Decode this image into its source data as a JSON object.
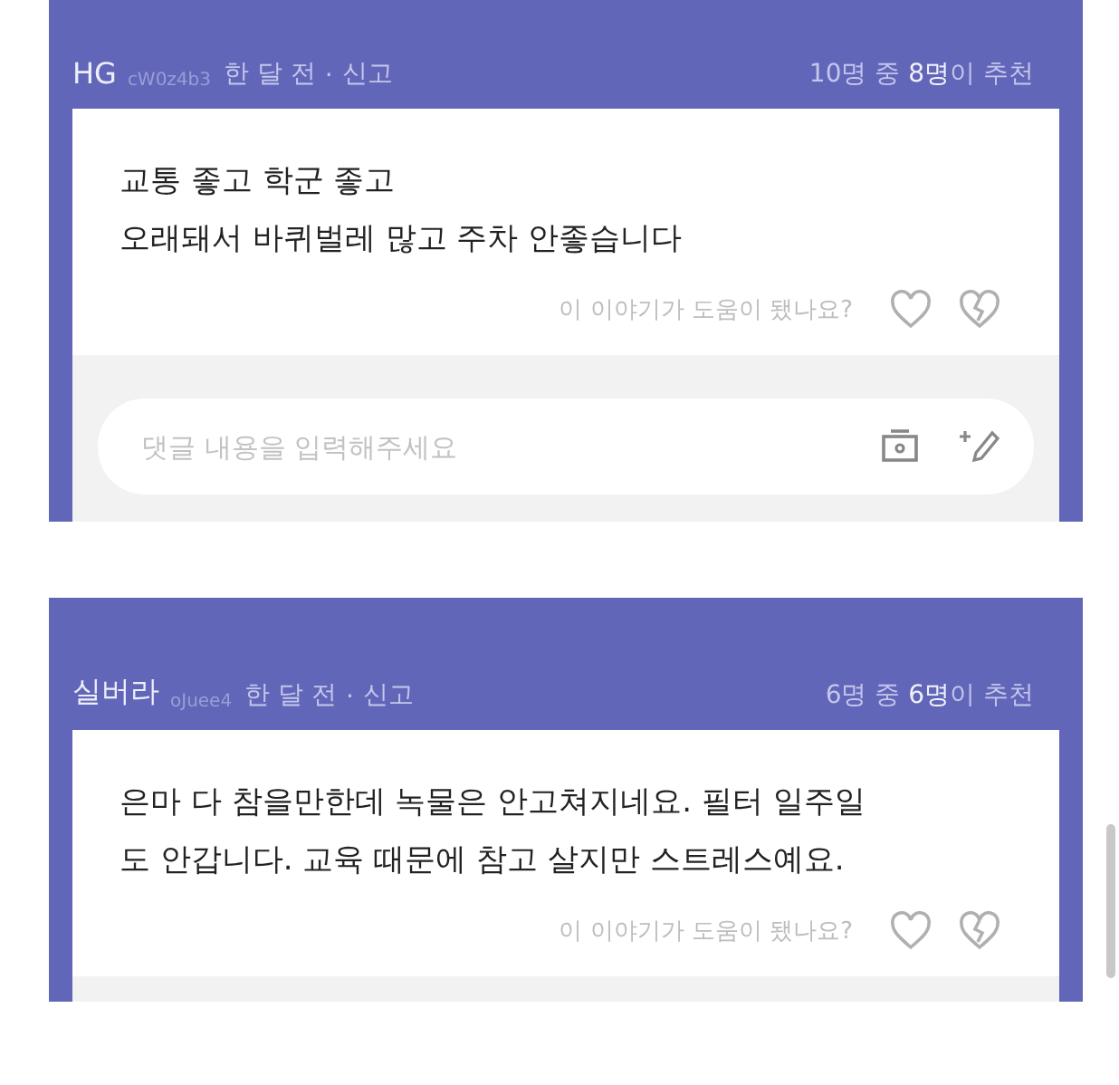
{
  "reviews": [
    {
      "author": "HG",
      "user_id": "cW0z4b3",
      "time": "한 달 전",
      "separator": "·",
      "report": "신고",
      "recommend": "10명 중 **8명**이 추천",
      "body": [
        "교통 좋고 학군 좋고",
        "오래돼서 바퀴벌레 많고 주차 안좋습니다"
      ],
      "helpful_prompt": "이 이야기가 도움이 됐나요?",
      "comment_placeholder": "댓글 내용을 입력해주세요"
    },
    {
      "author": "실버라",
      "user_id": "oJuee4",
      "time": "한 달 전",
      "separator": "·",
      "report": "신고",
      "recommend": "6명 중 **6명**이 추천",
      "body": [
        "은마 다 참을만한데 녹물은 안고쳐지네요. 필터 일주일 도 안갑니다. 교육 때문에 참고 살지만 스트레스예요."
      ],
      "helpful_prompt": "이 이야기가 도움이 됐나요?"
    }
  ]
}
